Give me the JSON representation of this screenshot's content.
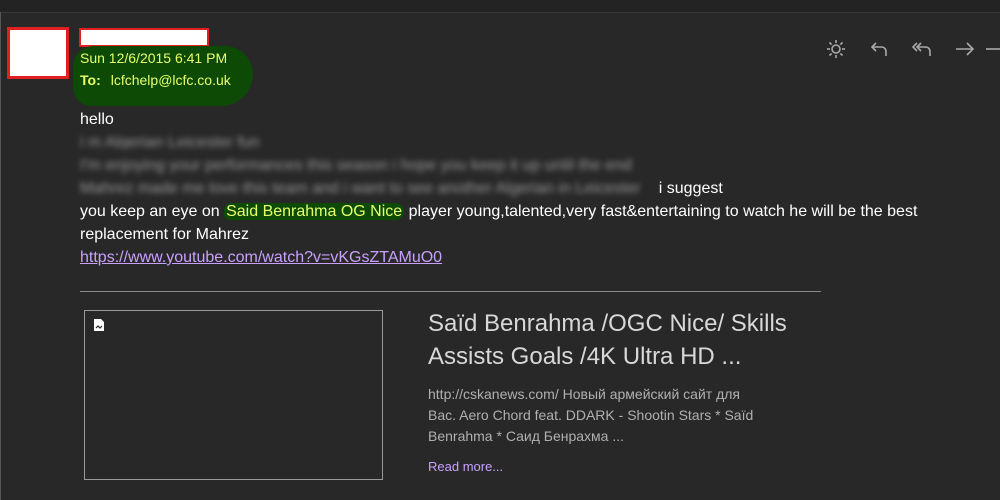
{
  "header": {
    "date": "Sun 12/6/2015 6:41 PM",
    "to_label": "To:",
    "to_address": "lcfchelp@lcfc.co.uk"
  },
  "toolbar": {
    "icons": [
      "sun-icon",
      "reply-icon",
      "reply-all-icon",
      "forward-icon",
      "more-icon"
    ]
  },
  "body": {
    "line1": "hello",
    "line2": "i m Algerian Leicester fun",
    "line3_blurred": "I'm enjoying your performances this season i hope you keep it up until the end",
    "line4_blurred": "Mahrez made me love this team and i want to see another  Algerian in Leicester",
    "line4_tail": "i suggest",
    "line5_pre": "you keep an eye on ",
    "line5_highlight": "Said Benrahma OG Nice",
    "line5_post": " player young,talented,very fast&entertaining to watch he will be the best",
    "line6": "replacement for Mahrez",
    "link": "https://www.youtube.com/watch?v=vKGsZTAMuO0"
  },
  "preview_card": {
    "title_line1": "Saïd Benrahma /OGC Nice/ Skills",
    "title_line2": "Assists Goals /4K Ultra HD ...",
    "desc_line1": "http://cskanews.com/ Новый армейский сайт для",
    "desc_line2": "Bac. Aero Chord feat. DDARK - Shootin Stars * Saïd",
    "desc_line3": "Benrahma * Саид Бенрахма ...",
    "read_more": "Read more..."
  },
  "colors": {
    "background": "#282828",
    "highlight_green": "#0c4a06",
    "highlight_text": "#e8ff6a",
    "link": "#c9a0ff",
    "redaction_border": "#e02020"
  }
}
